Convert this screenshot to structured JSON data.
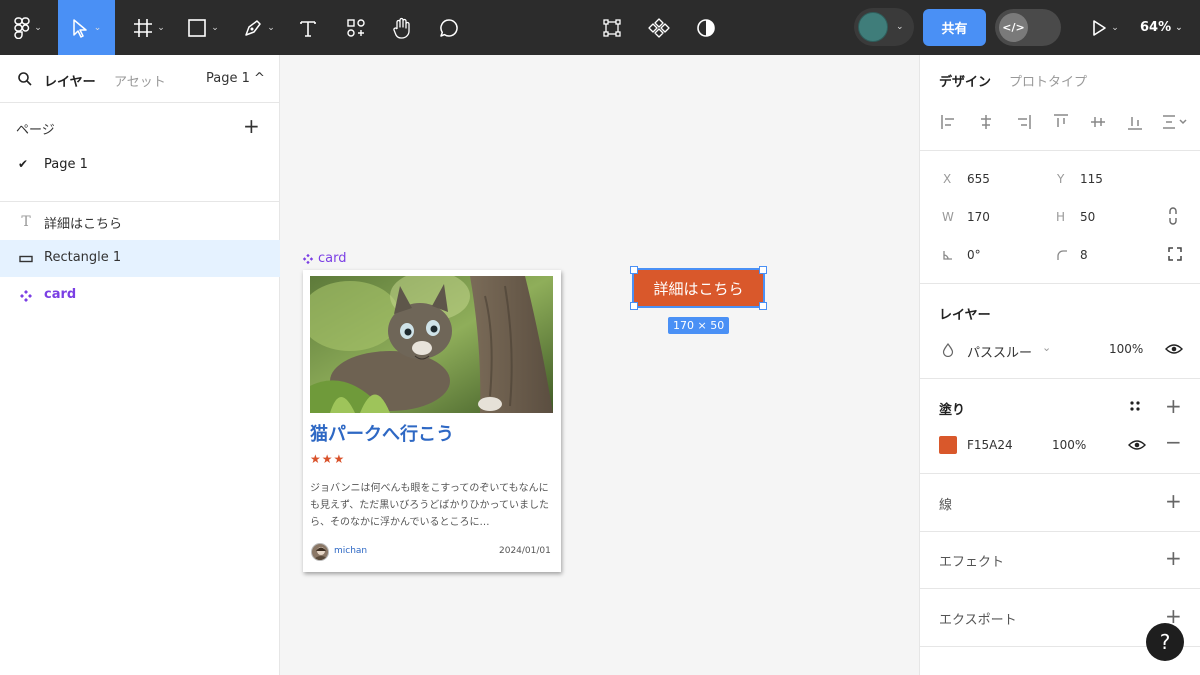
{
  "toolbar": {
    "share_label": "共有",
    "zoom_label": "64%",
    "dev_mode_icon": "code-icon"
  },
  "left_panel": {
    "tabs": {
      "layers": "レイヤー",
      "assets": "アセット",
      "page_switch": "Page 1 ^"
    },
    "pages_header": "ページ",
    "pages": [
      {
        "name": "Page 1",
        "active": true
      }
    ],
    "layers": [
      {
        "name": "詳細はこちら",
        "icon": "text-icon",
        "selected": false
      },
      {
        "name": "Rectangle 1",
        "icon": "rectangle-icon",
        "selected": true
      },
      {
        "name": "card",
        "icon": "component-icon",
        "selected": false
      }
    ]
  },
  "canvas": {
    "frame_label": "card",
    "card": {
      "title": "猫パークへ行こう",
      "stars": "★★★",
      "description": "ジョバンニは何べんも眼をこすってのぞいてもなんにも見えず、ただ黒いびろうどばかりひかっていましたら、そのなかに浮かんでいるところに…",
      "author": "michan",
      "date": "2024/01/01"
    },
    "selected_button": {
      "label": "詳細はこちら",
      "color": "#F15A24"
    },
    "size_tag": "170 × 50"
  },
  "right_panel": {
    "tabs": {
      "design": "デザイン",
      "prototype": "プロトタイプ"
    },
    "properties": {
      "x_label": "X",
      "x": "655",
      "y_label": "Y",
      "y": "115",
      "w_label": "W",
      "w": "170",
      "h_label": "H",
      "h": "50",
      "rotation": "0°",
      "radius": "8"
    },
    "layer_section": {
      "title": "レイヤー",
      "blend": "パススルー",
      "opacity": "100%"
    },
    "fill_section": {
      "title": "塗り",
      "hex": "F15A24",
      "opacity": "100%"
    },
    "stroke_title": "線",
    "effects_title": "エフェクト",
    "export_title": "エクスポート"
  },
  "help_label": "?"
}
